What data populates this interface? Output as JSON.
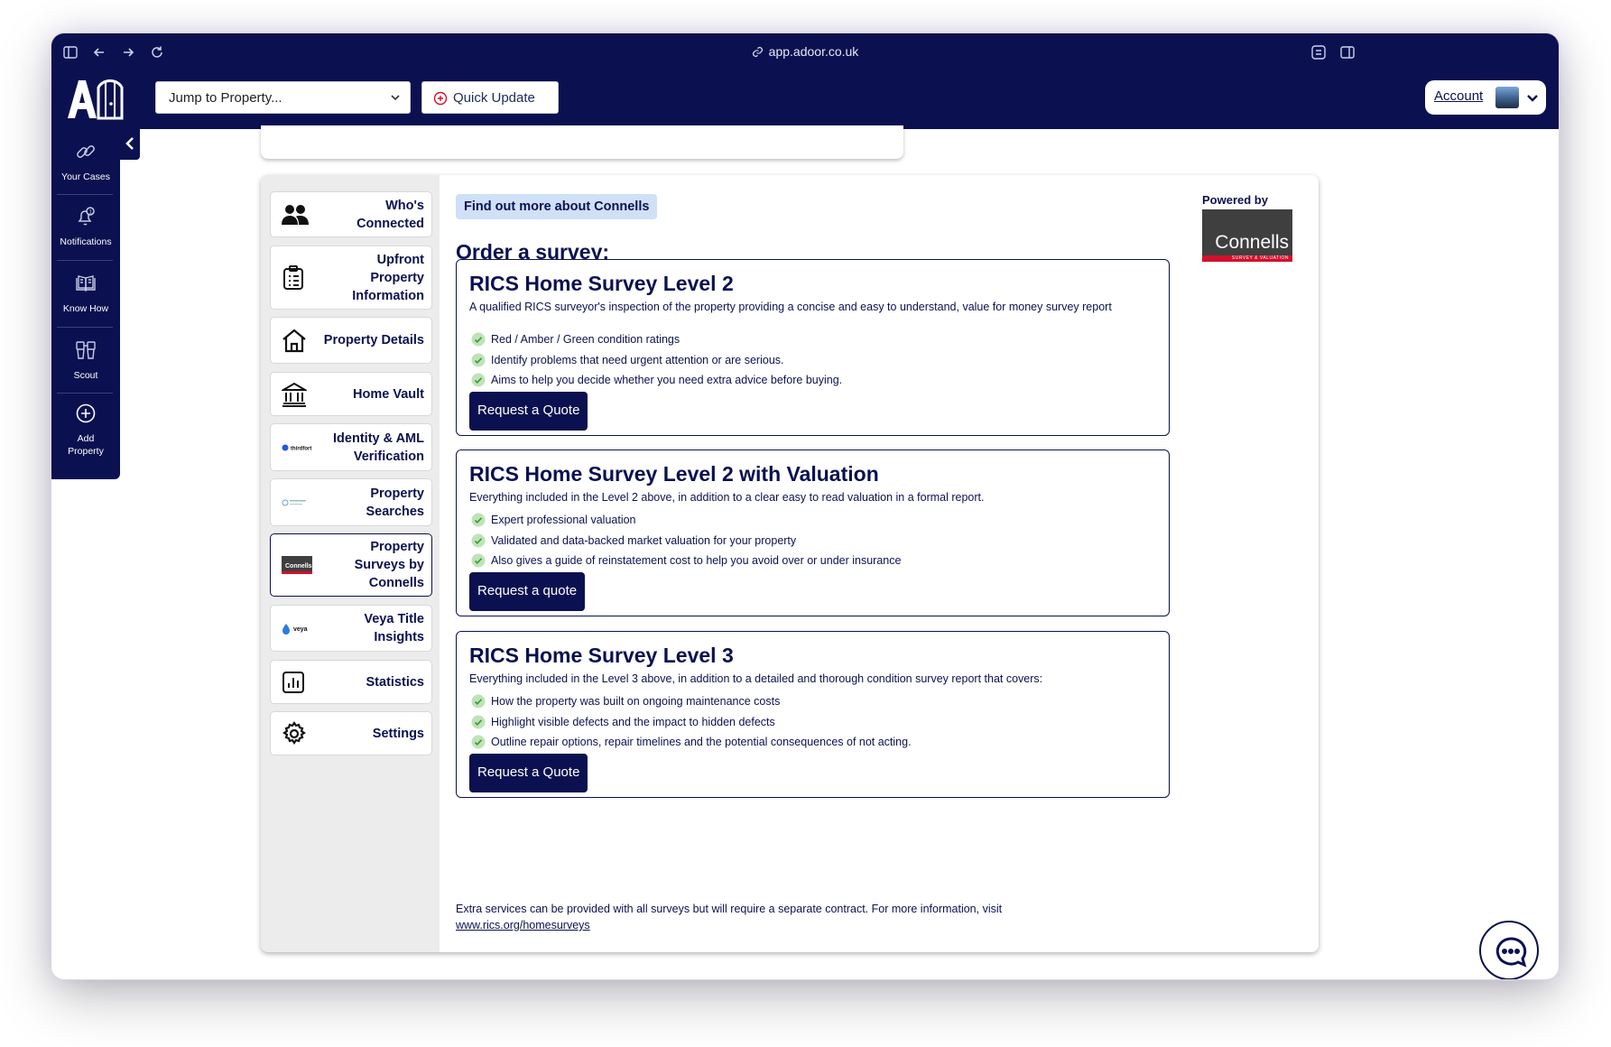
{
  "browser": {
    "url": "app.adoor.co.uk"
  },
  "header": {
    "jump_placeholder": "Jump to Property...",
    "quick_update_label": "Quick Update",
    "account_label": "Account"
  },
  "sidebar": {
    "items": [
      {
        "label": "Your Cases",
        "icon": "link-icon"
      },
      {
        "label": "Notifications",
        "icon": "bell-icon"
      },
      {
        "label": "Know How",
        "icon": "book-icon"
      },
      {
        "label": "Scout",
        "icon": "binoculars-icon"
      },
      {
        "label": "Add Property",
        "icon": "plus-circle-icon"
      }
    ]
  },
  "tabs": [
    {
      "label": "Who's Connected",
      "icon": "people-icon"
    },
    {
      "label": "Upfront Property Information",
      "icon": "clipboard-icon"
    },
    {
      "label": "Property Details",
      "icon": "house-icon"
    },
    {
      "label": "Home Vault",
      "icon": "bank-icon"
    },
    {
      "label": "Identity & AML Verification",
      "icon": "thirdfort-logo",
      "logo_text": "thirdfort"
    },
    {
      "label": "Property Searches",
      "icon": "searches-logo"
    },
    {
      "label": "Property Surveys by Connells",
      "icon": "connells-logo",
      "logo_text": "Connells",
      "active": true
    },
    {
      "label": "Veya Title Insights",
      "icon": "veya-logo",
      "logo_text": "veya"
    },
    {
      "label": "Statistics",
      "icon": "chart-icon"
    },
    {
      "label": "Settings",
      "icon": "gear-icon"
    }
  ],
  "content": {
    "badge": "Find out more about Connells",
    "order_title": "Order a survey:",
    "powered_by": "Powered by",
    "connells_logo": {
      "name": "Connells",
      "tagline": "SURVEY & VALUATION"
    },
    "surveys": [
      {
        "title": "RICS Home Survey Level 2",
        "description": "A qualified RICS surveyor's inspection of the property providing a concise and easy to understand, value for money survey report",
        "bullets": [
          "Red / Amber / Green condition ratings",
          "Identify problems that need urgent attention or are serious.",
          "Aims to help you decide whether you need extra advice before buying."
        ],
        "button": "Request a Quote"
      },
      {
        "title": "RICS Home Survey Level 2 with Valuation",
        "description": "Everything included in the Level 2 above, in addition to a clear easy to read valuation in a formal report.",
        "bullets": [
          "Expert professional valuation",
          "Validated and data-backed market valuation for your property",
          "Also gives a guide of reinstatement cost to help you avoid over or under insurance"
        ],
        "button": "Request a quote"
      },
      {
        "title": "RICS Home Survey Level 3",
        "description": "Everything included in the Level 3 above, in addition to a detailed and thorough condition survey report that covers:",
        "bullets": [
          "How the property was built on ongoing maintenance costs",
          "Highlight visible defects and the impact to hidden defects",
          "Outline repair options, repair timelines and the potential consequences of not acting."
        ],
        "button": "Request a Quote"
      }
    ],
    "footnote_text": "Extra services can be provided with all surveys but will require a separate contract. For more information, visit",
    "footnote_link": "www.rics.org/homesurveys"
  },
  "colors": {
    "navy": "#0b1150",
    "badge_bg": "#cfe0f7",
    "tick_green": "#5cb85c",
    "connells_red": "#d3102b"
  }
}
